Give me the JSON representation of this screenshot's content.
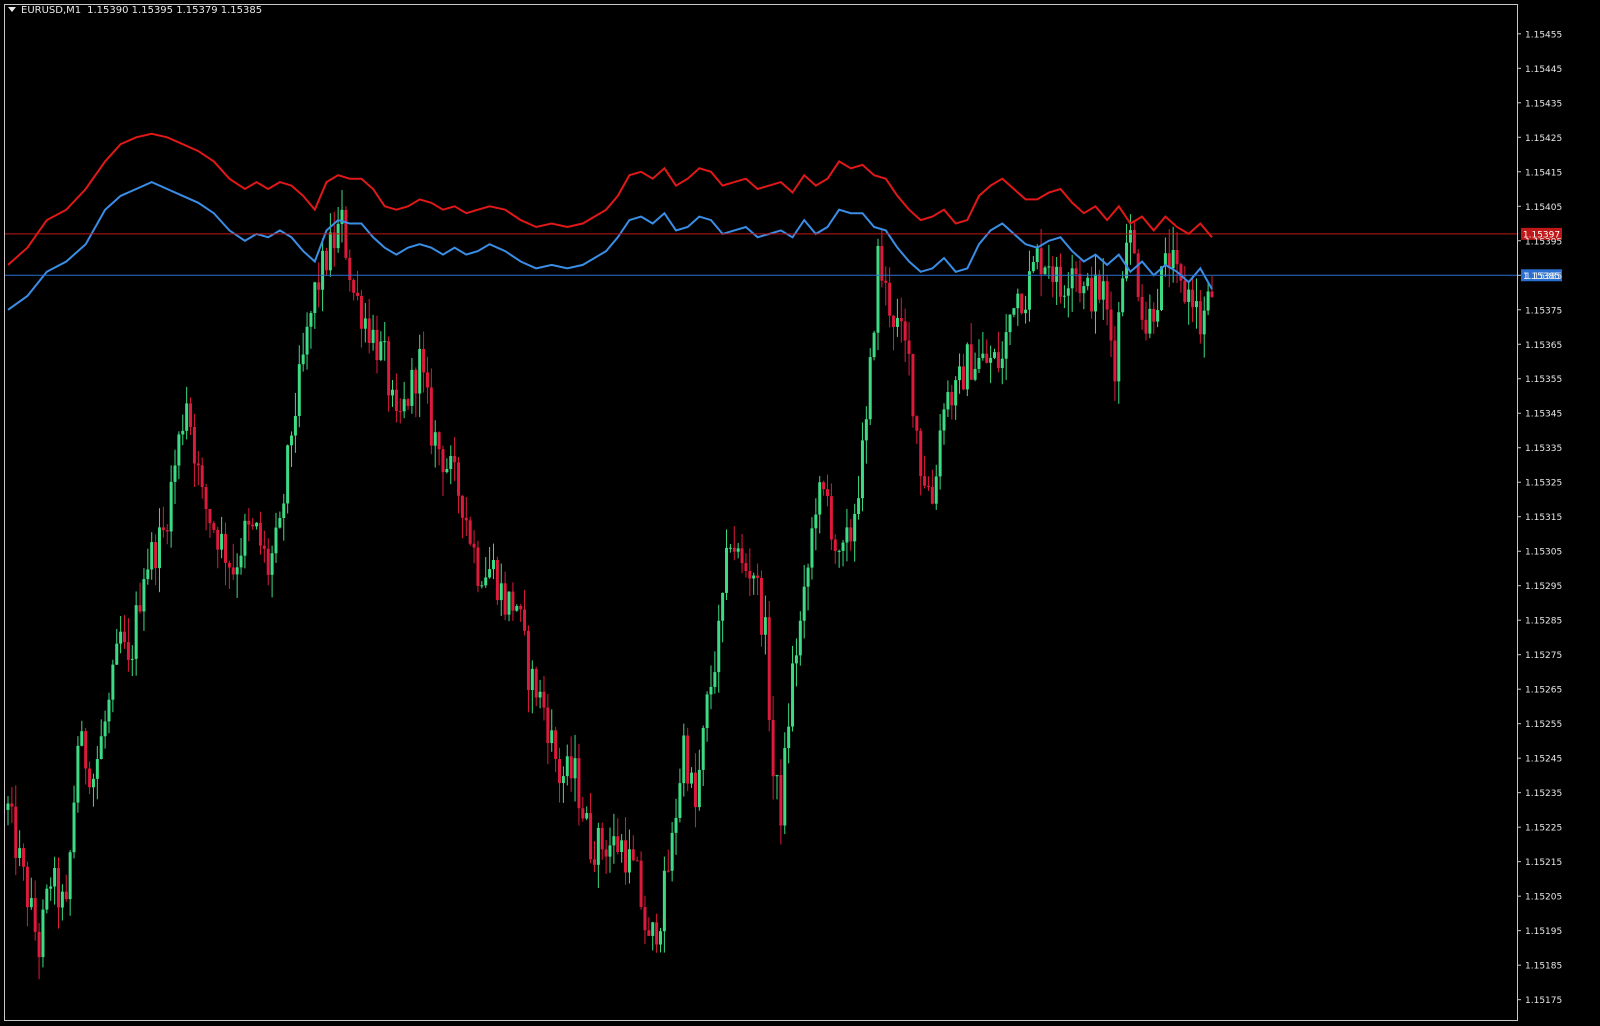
{
  "window": {
    "symbol": "EURUSD,M1",
    "open": "1.15390",
    "high": "1.15395",
    "low": "1.15379",
    "close": "1.15385"
  },
  "colors": {
    "background": "#000000",
    "frame": "#c8c8c8",
    "bull": "#3ddc84",
    "bear": "#dc1a3c",
    "upper_band": "#e01818",
    "lower_band": "#3a8ee6",
    "ask_line": "#c01818",
    "bid_line": "#2a6fd0",
    "axis_text": "#e6e6e6"
  },
  "chart_data": {
    "type": "candlestick",
    "timeframe": "M1",
    "ylim": [
      1.15172,
      1.15459
    ],
    "y_ticks": [
      "1.15455",
      "1.15445",
      "1.15435",
      "1.15425",
      "1.15415",
      "1.15405",
      "1.15395",
      "1.15385",
      "1.15375",
      "1.15365",
      "1.15355",
      "1.15345",
      "1.15335",
      "1.15325",
      "1.15315",
      "1.15305",
      "1.15295",
      "1.15285",
      "1.15275",
      "1.15265",
      "1.15255",
      "1.15245",
      "1.15235",
      "1.15225",
      "1.15215",
      "1.15205",
      "1.15195",
      "1.15185",
      "1.15175"
    ],
    "price_lines": [
      {
        "label": "1.15397",
        "value": 1.15397,
        "color": "#c01818"
      },
      {
        "label": "1.15385",
        "value": 1.15385,
        "color": "#2a6fd0"
      }
    ],
    "close_path": [
      [
        0,
        1.1523
      ],
      [
        8,
        1.1521
      ],
      [
        16,
        1.1519
      ],
      [
        22,
        1.1521
      ],
      [
        30,
        1.152
      ],
      [
        36,
        1.1525
      ],
      [
        44,
        1.1524
      ],
      [
        52,
        1.1526
      ],
      [
        58,
        1.1528
      ],
      [
        62,
        1.1527
      ],
      [
        70,
        1.153
      ],
      [
        80,
        1.1531
      ],
      [
        92,
        1.1535
      ],
      [
        100,
        1.1532
      ],
      [
        108,
        1.1531
      ],
      [
        116,
        1.153
      ],
      [
        122,
        1.1531
      ],
      [
        128,
        1.1531
      ],
      [
        134,
        1.153
      ],
      [
        140,
        1.1531
      ],
      [
        146,
        1.1534
      ],
      [
        152,
        1.1536
      ],
      [
        158,
        1.1538
      ],
      [
        164,
        1.1539
      ],
      [
        172,
        1.154
      ],
      [
        178,
        1.1538
      ],
      [
        186,
        1.1537
      ],
      [
        194,
        1.1536
      ],
      [
        200,
        1.1534
      ],
      [
        206,
        1.1535
      ],
      [
        212,
        1.1536
      ],
      [
        218,
        1.1534
      ],
      [
        226,
        1.1533
      ],
      [
        234,
        1.1532
      ],
      [
        242,
        1.153
      ],
      [
        250,
        1.153
      ],
      [
        256,
        1.1529
      ],
      [
        262,
        1.1529
      ],
      [
        268,
        1.1527
      ],
      [
        276,
        1.1526
      ],
      [
        284,
        1.1524
      ],
      [
        292,
        1.1524
      ],
      [
        300,
        1.1522
      ],
      [
        308,
        1.1522
      ],
      [
        316,
        1.1522
      ],
      [
        324,
        1.1521
      ],
      [
        330,
        1.1519
      ],
      [
        336,
        1.152
      ],
      [
        342,
        1.1522
      ],
      [
        348,
        1.1525
      ],
      [
        354,
        1.1523
      ],
      [
        360,
        1.1526
      ],
      [
        366,
        1.1528
      ],
      [
        372,
        1.1531
      ],
      [
        378,
        1.153
      ],
      [
        384,
        1.153
      ],
      [
        390,
        1.1528
      ],
      [
        394,
        1.1524
      ],
      [
        398,
        1.1523
      ],
      [
        404,
        1.1527
      ],
      [
        410,
        1.1529
      ],
      [
        416,
        1.1532
      ],
      [
        422,
        1.1532
      ],
      [
        428,
        1.153
      ],
      [
        434,
        1.1531
      ],
      [
        442,
        1.1534
      ],
      [
        448,
        1.1539
      ],
      [
        452,
        1.1538
      ],
      [
        458,
        1.1537
      ],
      [
        464,
        1.1536
      ],
      [
        470,
        1.1533
      ],
      [
        476,
        1.1532
      ],
      [
        482,
        1.1535
      ],
      [
        488,
        1.1535
      ],
      [
        494,
        1.1536
      ],
      [
        500,
        1.1536
      ],
      [
        506,
        1.1536
      ],
      [
        512,
        1.1536
      ],
      [
        518,
        1.1538
      ],
      [
        524,
        1.1538
      ],
      [
        530,
        1.1539
      ],
      [
        536,
        1.1539
      ],
      [
        542,
        1.1538
      ],
      [
        548,
        1.1539
      ],
      [
        554,
        1.1538
      ],
      [
        560,
        1.1538
      ],
      [
        564,
        1.1538
      ],
      [
        570,
        1.1536
      ],
      [
        576,
        1.154
      ],
      [
        580,
        1.1539
      ],
      [
        586,
        1.1537
      ],
      [
        592,
        1.1538
      ],
      [
        598,
        1.1539
      ],
      [
        604,
        1.1538
      ],
      [
        610,
        1.1538
      ],
      [
        614,
        1.1537
      ],
      [
        620,
        1.1538
      ]
    ],
    "upper_band_path": [
      [
        0,
        1.15388
      ],
      [
        10,
        1.15393
      ],
      [
        20,
        1.15401
      ],
      [
        30,
        1.15404
      ],
      [
        40,
        1.1541
      ],
      [
        50,
        1.15418
      ],
      [
        58,
        1.15423
      ],
      [
        66,
        1.15425
      ],
      [
        74,
        1.15426
      ],
      [
        82,
        1.15425
      ],
      [
        90,
        1.15423
      ],
      [
        98,
        1.15421
      ],
      [
        106,
        1.15418
      ],
      [
        114,
        1.15413
      ],
      [
        122,
        1.1541
      ],
      [
        128,
        1.15412
      ],
      [
        134,
        1.1541
      ],
      [
        140,
        1.15412
      ],
      [
        146,
        1.15411
      ],
      [
        152,
        1.15408
      ],
      [
        158,
        1.15404
      ],
      [
        164,
        1.15412
      ],
      [
        170,
        1.15414
      ],
      [
        176,
        1.15413
      ],
      [
        182,
        1.15413
      ],
      [
        188,
        1.1541
      ],
      [
        194,
        1.15405
      ],
      [
        200,
        1.15404
      ],
      [
        206,
        1.15405
      ],
      [
        212,
        1.15407
      ],
      [
        218,
        1.15406
      ],
      [
        224,
        1.15404
      ],
      [
        230,
        1.15405
      ],
      [
        236,
        1.15403
      ],
      [
        242,
        1.15404
      ],
      [
        248,
        1.15405
      ],
      [
        256,
        1.15404
      ],
      [
        264,
        1.15401
      ],
      [
        272,
        1.15399
      ],
      [
        280,
        1.154
      ],
      [
        288,
        1.15399
      ],
      [
        296,
        1.154
      ],
      [
        302,
        1.15402
      ],
      [
        308,
        1.15404
      ],
      [
        314,
        1.15408
      ],
      [
        320,
        1.15414
      ],
      [
        326,
        1.15415
      ],
      [
        332,
        1.15413
      ],
      [
        338,
        1.15416
      ],
      [
        344,
        1.15411
      ],
      [
        350,
        1.15413
      ],
      [
        356,
        1.15416
      ],
      [
        362,
        1.15415
      ],
      [
        368,
        1.15411
      ],
      [
        374,
        1.15412
      ],
      [
        380,
        1.15413
      ],
      [
        386,
        1.1541
      ],
      [
        392,
        1.15411
      ],
      [
        398,
        1.15412
      ],
      [
        404,
        1.15409
      ],
      [
        410,
        1.15414
      ],
      [
        416,
        1.15411
      ],
      [
        422,
        1.15413
      ],
      [
        428,
        1.15418
      ],
      [
        434,
        1.15416
      ],
      [
        440,
        1.15417
      ],
      [
        446,
        1.15414
      ],
      [
        452,
        1.15413
      ],
      [
        458,
        1.15408
      ],
      [
        464,
        1.15404
      ],
      [
        470,
        1.15401
      ],
      [
        476,
        1.15402
      ],
      [
        482,
        1.15404
      ],
      [
        488,
        1.154
      ],
      [
        494,
        1.15401
      ],
      [
        500,
        1.15408
      ],
      [
        506,
        1.15411
      ],
      [
        512,
        1.15413
      ],
      [
        518,
        1.1541
      ],
      [
        524,
        1.15407
      ],
      [
        530,
        1.15407
      ],
      [
        536,
        1.15409
      ],
      [
        542,
        1.1541
      ],
      [
        548,
        1.15406
      ],
      [
        554,
        1.15403
      ],
      [
        560,
        1.15405
      ],
      [
        566,
        1.15401
      ],
      [
        572,
        1.15405
      ],
      [
        578,
        1.154
      ],
      [
        584,
        1.15402
      ],
      [
        590,
        1.15398
      ],
      [
        596,
        1.15402
      ],
      [
        602,
        1.15399
      ],
      [
        608,
        1.15397
      ],
      [
        614,
        1.154
      ],
      [
        620,
        1.15396
      ]
    ],
    "lower_band_path": [
      [
        0,
        1.15375
      ],
      [
        10,
        1.15379
      ],
      [
        20,
        1.15386
      ],
      [
        30,
        1.15389
      ],
      [
        40,
        1.15394
      ],
      [
        50,
        1.15404
      ],
      [
        58,
        1.15408
      ],
      [
        66,
        1.1541
      ],
      [
        74,
        1.15412
      ],
      [
        82,
        1.1541
      ],
      [
        90,
        1.15408
      ],
      [
        98,
        1.15406
      ],
      [
        106,
        1.15403
      ],
      [
        114,
        1.15398
      ],
      [
        122,
        1.15395
      ],
      [
        128,
        1.15397
      ],
      [
        134,
        1.15396
      ],
      [
        140,
        1.15398
      ],
      [
        146,
        1.15396
      ],
      [
        152,
        1.15392
      ],
      [
        158,
        1.15389
      ],
      [
        164,
        1.15398
      ],
      [
        170,
        1.15401
      ],
      [
        176,
        1.154
      ],
      [
        182,
        1.154
      ],
      [
        188,
        1.15396
      ],
      [
        194,
        1.15393
      ],
      [
        200,
        1.15391
      ],
      [
        206,
        1.15393
      ],
      [
        212,
        1.15394
      ],
      [
        218,
        1.15393
      ],
      [
        224,
        1.15391
      ],
      [
        230,
        1.15393
      ],
      [
        236,
        1.15391
      ],
      [
        242,
        1.15392
      ],
      [
        248,
        1.15394
      ],
      [
        256,
        1.15392
      ],
      [
        264,
        1.15389
      ],
      [
        272,
        1.15387
      ],
      [
        280,
        1.15388
      ],
      [
        288,
        1.15387
      ],
      [
        296,
        1.15388
      ],
      [
        302,
        1.1539
      ],
      [
        308,
        1.15392
      ],
      [
        314,
        1.15396
      ],
      [
        320,
        1.15401
      ],
      [
        326,
        1.15402
      ],
      [
        332,
        1.154
      ],
      [
        338,
        1.15403
      ],
      [
        344,
        1.15398
      ],
      [
        350,
        1.15399
      ],
      [
        356,
        1.15402
      ],
      [
        362,
        1.15401
      ],
      [
        368,
        1.15397
      ],
      [
        374,
        1.15398
      ],
      [
        380,
        1.15399
      ],
      [
        386,
        1.15396
      ],
      [
        392,
        1.15397
      ],
      [
        398,
        1.15398
      ],
      [
        404,
        1.15396
      ],
      [
        410,
        1.15401
      ],
      [
        416,
        1.15397
      ],
      [
        422,
        1.15399
      ],
      [
        428,
        1.15404
      ],
      [
        434,
        1.15403
      ],
      [
        440,
        1.15403
      ],
      [
        446,
        1.15399
      ],
      [
        452,
        1.15398
      ],
      [
        458,
        1.15393
      ],
      [
        464,
        1.15389
      ],
      [
        470,
        1.15386
      ],
      [
        476,
        1.15387
      ],
      [
        482,
        1.1539
      ],
      [
        488,
        1.15386
      ],
      [
        494,
        1.15387
      ],
      [
        500,
        1.15394
      ],
      [
        506,
        1.15398
      ],
      [
        512,
        1.154
      ],
      [
        518,
        1.15397
      ],
      [
        524,
        1.15394
      ],
      [
        530,
        1.15393
      ],
      [
        536,
        1.15395
      ],
      [
        542,
        1.15396
      ],
      [
        548,
        1.15392
      ],
      [
        554,
        1.15389
      ],
      [
        560,
        1.15391
      ],
      [
        566,
        1.15388
      ],
      [
        572,
        1.15391
      ],
      [
        578,
        1.15386
      ],
      [
        584,
        1.15389
      ],
      [
        590,
        1.15385
      ],
      [
        596,
        1.15388
      ],
      [
        602,
        1.15386
      ],
      [
        608,
        1.15383
      ],
      [
        614,
        1.15387
      ],
      [
        620,
        1.15381
      ]
    ]
  }
}
